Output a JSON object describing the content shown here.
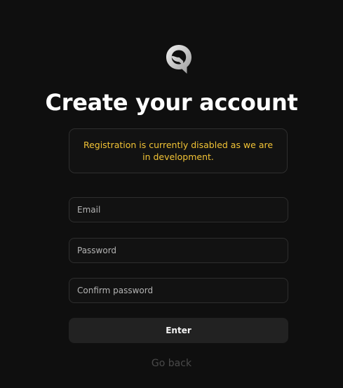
{
  "header": {
    "logo_icon": "q-logo-icon",
    "title": "Create your account"
  },
  "notice": {
    "text": "Registration is currently disabled as we are in development.",
    "color": "#f2c335"
  },
  "form": {
    "email": {
      "placeholder": "Email",
      "value": ""
    },
    "password": {
      "placeholder": "Password",
      "value": ""
    },
    "confirm_password": {
      "placeholder": "Confirm password",
      "value": ""
    },
    "submit_label": "Enter",
    "back_label": "Go back"
  }
}
